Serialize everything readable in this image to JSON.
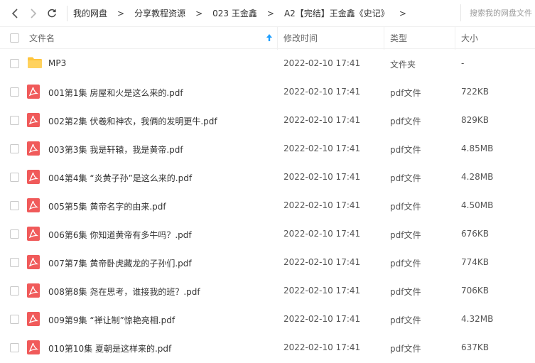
{
  "breadcrumb": [
    "我的网盘",
    "分享教程资源",
    "023 王金鑫",
    "A2【完结】王金鑫《史记》"
  ],
  "search": {
    "placeholder": "搜索我的网盘文件"
  },
  "columns": {
    "name": "文件名",
    "date": "修改时间",
    "type": "类型",
    "size": "大小"
  },
  "files": [
    {
      "name": "MP3",
      "date": "2022-02-10 17:41",
      "type": "文件夹",
      "size": "-",
      "icon": "folder-icon"
    },
    {
      "name": "001第1集 房屋和火是这么来的.pdf",
      "date": "2022-02-10 17:41",
      "type": "pdf文件",
      "size": "722KB",
      "icon": "pdf-icon"
    },
    {
      "name": "002第2集 伏羲和神农，我俩的发明更牛.pdf",
      "date": "2022-02-10 17:41",
      "type": "pdf文件",
      "size": "829KB",
      "icon": "pdf-icon"
    },
    {
      "name": "003第3集 我是轩辕，我是黄帝.pdf",
      "date": "2022-02-10 17:41",
      "type": "pdf文件",
      "size": "4.85MB",
      "icon": "pdf-icon"
    },
    {
      "name": "004第4集 “炎黄子孙”是这么来的.pdf",
      "date": "2022-02-10 17:41",
      "type": "pdf文件",
      "size": "4.28MB",
      "icon": "pdf-icon"
    },
    {
      "name": "005第5集 黄帝名字的由来.pdf",
      "date": "2022-02-10 17:41",
      "type": "pdf文件",
      "size": "4.50MB",
      "icon": "pdf-icon"
    },
    {
      "name": "006第6集 你知道黄帝有多牛吗？.pdf",
      "date": "2022-02-10 17:41",
      "type": "pdf文件",
      "size": "676KB",
      "icon": "pdf-icon"
    },
    {
      "name": "007第7集 黄帝卧虎藏龙的子孙们.pdf",
      "date": "2022-02-10 17:41",
      "type": "pdf文件",
      "size": "774KB",
      "icon": "pdf-icon"
    },
    {
      "name": "008第8集 尧在思考，谁接我的班？.pdf",
      "date": "2022-02-10 17:41",
      "type": "pdf文件",
      "size": "706KB",
      "icon": "pdf-icon"
    },
    {
      "name": "009第9集 “禅让制”惊艳亮相.pdf",
      "date": "2022-02-10 17:41",
      "type": "pdf文件",
      "size": "4.32MB",
      "icon": "pdf-icon"
    },
    {
      "name": "010第10集 夏朝是这样来的.pdf",
      "date": "2022-02-10 17:41",
      "type": "pdf文件",
      "size": "637KB",
      "icon": "pdf-icon"
    }
  ],
  "colors": {
    "accent": "#1e9fff",
    "pdf": "#f05a5a",
    "folder": "#ffc53d"
  }
}
